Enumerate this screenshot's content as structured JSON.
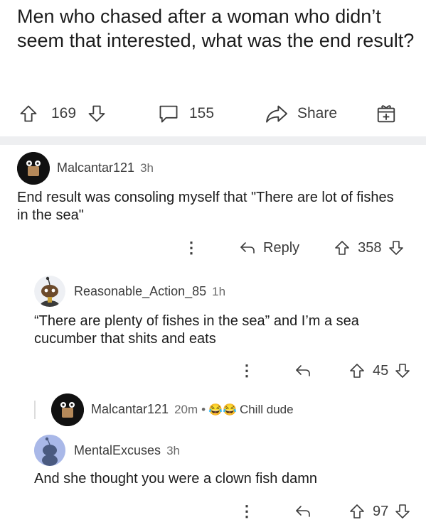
{
  "post": {
    "title": "Men who chased after a woman who didn’t seem that interested, what was the end result?",
    "upvotes": "169",
    "comments": "155",
    "share_label": "Share"
  },
  "comments": [
    {
      "username": "Malcantar121",
      "time": "3h",
      "text": "End result was consoling myself that \"There are lot of fishes in the sea\"",
      "reply_label": "Reply",
      "votes": "358"
    },
    {
      "username": "Reasonable_Action_85",
      "time": "1h",
      "text": "“There are plenty of fishes in the sea” and I’m a sea cucumber that shits and eats",
      "votes": "45"
    },
    {
      "username": "Malcantar121",
      "time": "20m",
      "separator": "•",
      "emoji": "😂😂",
      "text": "Chill dude"
    },
    {
      "username": "MentalExcuses",
      "time": "3h",
      "text": "And she thought you were a clown fish damn",
      "votes": "97"
    }
  ],
  "colors": {
    "divider": "#eeeff1",
    "text": "#1c1c1c",
    "icon": "#3c3c3c",
    "avatar_blue": "#a9b8e8"
  }
}
